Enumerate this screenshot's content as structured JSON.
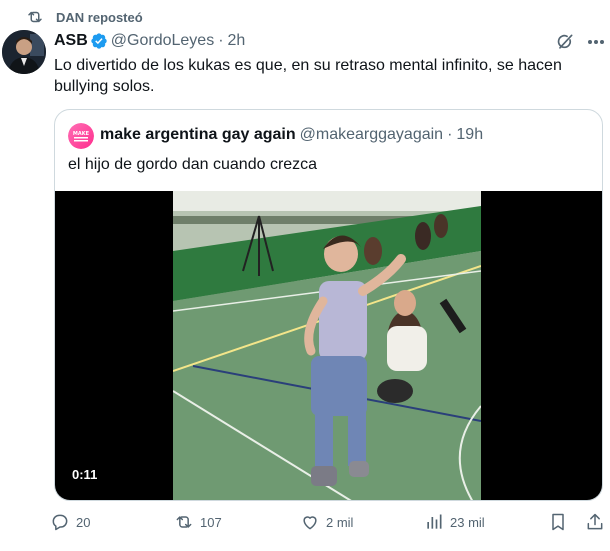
{
  "repost": {
    "label": "DAN reposteó",
    "icon": "repost-icon"
  },
  "post": {
    "author_name": "ASB",
    "handle": "@GordoLeyes",
    "separator": "·",
    "time": "2h",
    "text": "Lo divertido de los kukas es que, en su retraso mental infinito, se hacen bullying solos.",
    "verified_color": "#1d9bf0"
  },
  "quoted": {
    "author_name": "make argentina gay again",
    "handle": "@makearggayagain",
    "separator": "·",
    "time": "19h",
    "text": "el hijo de gordo dan cuando crezca",
    "avatar_label": "MAKE",
    "video": {
      "duration": "0:11"
    }
  },
  "actions": {
    "replies": "20",
    "reposts": "107",
    "likes": "2 mil",
    "views": "23 mil"
  },
  "colors": {
    "text": "#0f1419",
    "secondary": "#536471",
    "border": "#cfd9de",
    "accent": "#1d9bf0"
  }
}
